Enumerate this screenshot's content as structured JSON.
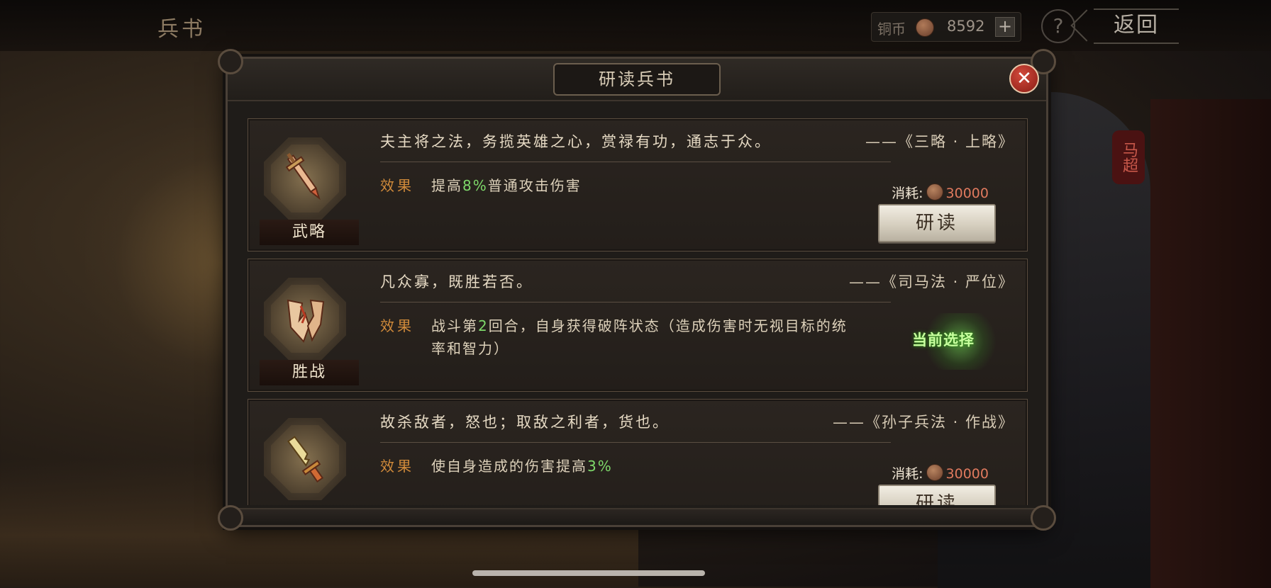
{
  "topbar": {
    "title": "兵书",
    "coin_label": "铜币",
    "coin_value": "8592",
    "coin_plus": "+",
    "help": "?",
    "back": "返回"
  },
  "hero_tag": "马超",
  "dialog": {
    "title": "研读兵书",
    "close": "✕"
  },
  "books": [
    {
      "name": "武略",
      "quote": "夫主将之法，务揽英雄之心，赏禄有功，通志于众。",
      "source": "——《三略 · 上略》",
      "effect_label": "效果",
      "effect_pre": "提高",
      "effect_hl": "8%",
      "effect_post": "普通攻击伤害",
      "cost_label": "消耗:",
      "cost_value": "30000",
      "button": "研读",
      "icon": "sword-icon"
    },
    {
      "name": "胜战",
      "quote": "凡众寡，既胜若否。",
      "source": "——《司马法 · 严位》",
      "effect_label": "效果",
      "effect_pre": "战斗第",
      "effect_hl": "2",
      "effect_post": "回合，自身获得破阵状态（造成伤害时无视目标的统率和智力）",
      "selected": "当前选择",
      "icon": "broken-shield-icon"
    },
    {
      "name": "",
      "quote": "故杀敌者，怒也；取敌之利者，货也。",
      "source": "——《孙子兵法 · 作战》",
      "effect_label": "效果",
      "effect_pre": "使自身造成的伤害提高",
      "effect_hl": "3%",
      "effect_post": "",
      "cost_label": "消耗:",
      "cost_value": "30000",
      "button": "研读",
      "icon": "broken-sword-icon"
    }
  ]
}
